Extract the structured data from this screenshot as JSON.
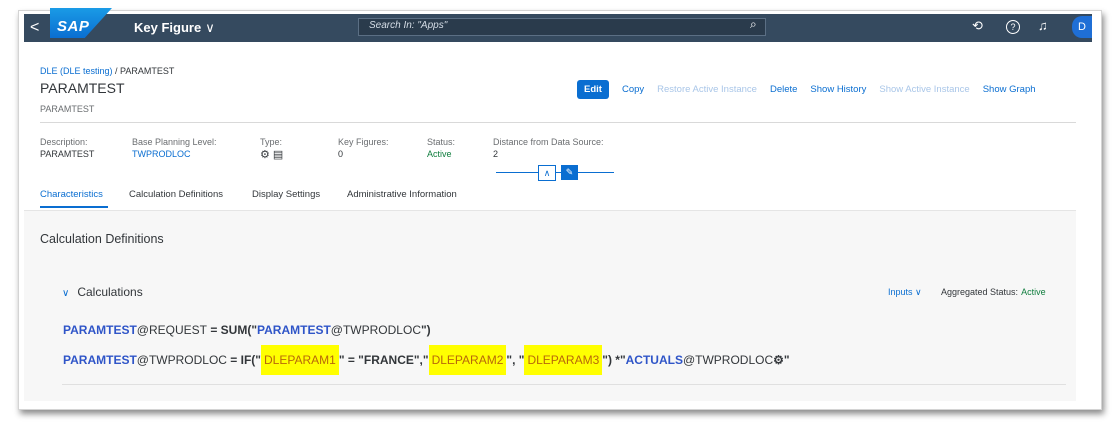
{
  "shell": {
    "back": "<",
    "logo": "SAP",
    "title": "Key Figure",
    "title_chevron": "∨",
    "search_placeholder": "Search In: \"Apps\"",
    "search_icon": "⌕",
    "help_icon": "⟲",
    "question_icon": "?",
    "bell_icon": "♫",
    "avatar": "D"
  },
  "breadcrumb": {
    "parent": "DLE (DLE testing)",
    "sep": " / ",
    "current": "PARAMTEST"
  },
  "object": {
    "title": "PARAMTEST",
    "subtitle": "PARAMTEST"
  },
  "actions": {
    "edit": "Edit",
    "copy": "Copy",
    "restore": "Restore Active Instance",
    "delete": "Delete",
    "history": "Show History",
    "show_active": "Show Active Instance",
    "graph": "Show Graph"
  },
  "header_fields": {
    "description_label": "Description:",
    "description_value": "PARAMTEST",
    "planning_label": "Base Planning Level:",
    "planning_value": "TWPRODLOC",
    "type_label": "Type:",
    "type_icons": "⚙ ▤",
    "kf_label": "Key Figures:",
    "kf_value": "0",
    "status_label": "Status:",
    "status_value": "Active",
    "distance_label": "Distance from Data Source:",
    "distance_value": "2"
  },
  "header_controls": {
    "collapse": "∧",
    "pin": "✎"
  },
  "tabs": [
    "Characteristics",
    "Calculation Definitions",
    "Display Settings",
    "Administrative Information"
  ],
  "section": {
    "title": "Calculation Definitions",
    "calc_chevron": "∨",
    "calc_title": "Calculations",
    "inputs": "Inputs ∨",
    "agg_label": "Aggregated Status:",
    "agg_value": "Active"
  },
  "formula1": {
    "kf": "PARAMTEST",
    "lvl": "@REQUEST",
    "op": " = SUM(\"",
    "kf2": "PARAMTEST",
    "lvl2": "@TWPRODLOC",
    "end": "\")"
  },
  "formula2": {
    "kf": "PARAMTEST",
    "lvl": "@TWPRODLOC",
    "op": " = IF(\"",
    "p1": "DLEPARAM1",
    "mid1": "\" = \"FRANCE\",\"",
    "p2": "DLEPARAM2",
    "mid2": "\", \"",
    "p3": "DLEPARAM3",
    "mid3": "\") *\"",
    "kf3": "ACTUALS",
    "lvl3": "@TWPRODLOC",
    "icon": "⚙",
    "end": "\""
  },
  "colors": {
    "shell": "#354a5f",
    "accent": "#0a6ed1",
    "positive": "#107e3e",
    "highlight": "#ffff00",
    "param_text": "#b8680a",
    "kf_text": "#2f55c8"
  }
}
